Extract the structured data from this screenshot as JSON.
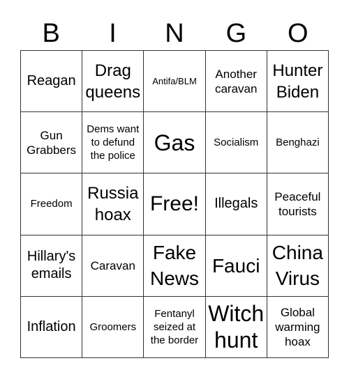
{
  "header": {
    "letters": [
      "B",
      "I",
      "N",
      "G",
      "O"
    ]
  },
  "board": {
    "rows": [
      [
        "Reagan",
        "Drag queens",
        "Antifa/BLM",
        "Another caravan",
        "Hunter Biden"
      ],
      [
        "Gun Grabbers",
        "Dems want to defund the police",
        "Gas",
        "Socialism",
        "Benghazi"
      ],
      [
        "Freedom",
        "Russia hoax",
        "Free!",
        "Illegals",
        "Peaceful tourists"
      ],
      [
        "Hillary's emails",
        "Caravan",
        "Fake News",
        "Fauci",
        "China Virus"
      ],
      [
        "Inflation",
        "Groomers",
        "Fentanyl seized at the border",
        "Witch hunt",
        "Global warming hoax"
      ]
    ]
  }
}
